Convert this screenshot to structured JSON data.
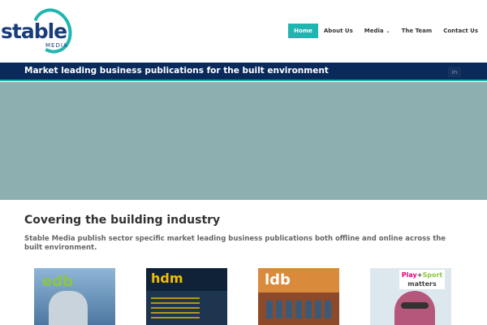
{
  "brand": {
    "name": "stable",
    "sub": "MEDIA",
    "accent": "#1fb5b0",
    "navy": "#0a2a5c"
  },
  "nav": {
    "items": [
      {
        "label": "Home",
        "active": true
      },
      {
        "label": "About Us"
      },
      {
        "label": "Media",
        "caret": "chevron-down-icon"
      },
      {
        "label": "The Team"
      },
      {
        "label": "Contact Us"
      }
    ]
  },
  "bar": {
    "title": "Market leading business publications for the built environment",
    "social": "in"
  },
  "content": {
    "title": "Covering the building industry",
    "text": "Stable Media publish sector specific market leading business publications both offline and online across the built environment."
  },
  "magazines": [
    {
      "logo": "edb"
    },
    {
      "logo": "hdm"
    },
    {
      "logo": "ldb"
    },
    {
      "logo_play": "Play",
      "logo_plus": "+",
      "logo_sport": "Sport",
      "logo_matters": "matters"
    }
  ]
}
